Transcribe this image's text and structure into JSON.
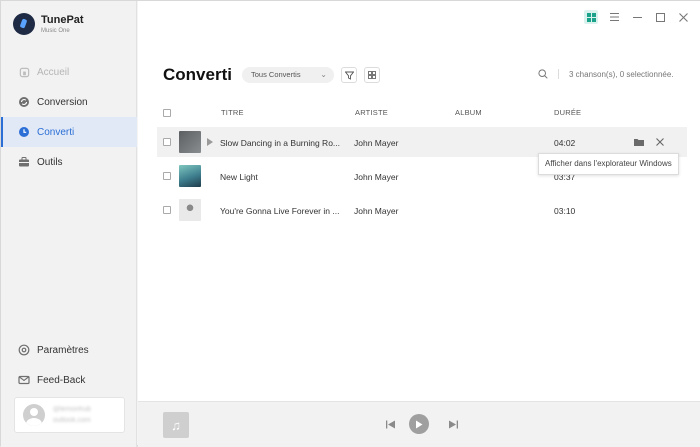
{
  "app": {
    "name": "TunePat",
    "subtitle": "Music One"
  },
  "colors": {
    "accent": "#2b6fd6",
    "active_bg": "#e1e9f6"
  },
  "sidebar": {
    "items": [
      {
        "label": "Accueil",
        "icon": "home-icon",
        "state": "disabled"
      },
      {
        "label": "Conversion",
        "icon": "refresh-icon",
        "state": "normal"
      },
      {
        "label": "Converti",
        "icon": "clock-icon",
        "state": "active"
      },
      {
        "label": "Outils",
        "icon": "toolbox-icon",
        "state": "normal"
      }
    ],
    "bottom_items": [
      {
        "label": "Paramètres",
        "icon": "gear-icon"
      },
      {
        "label": "Feed-Back",
        "icon": "mail-icon"
      }
    ],
    "user": {
      "line1": "@lemonhub",
      "line2": "outlook.com"
    }
  },
  "window_controls": [
    "grid-view-icon",
    "menu-icon",
    "minimize-icon",
    "maximize-icon",
    "close-icon"
  ],
  "main": {
    "title": "Converti",
    "filter": {
      "selected": "Tous Convertis"
    },
    "count_text": "3 chanson(s), 0 selectionnée.",
    "columns": {
      "title": "TITRE",
      "artist": "ARTISTE",
      "album": "ALBUM",
      "duration": "DURÉE"
    },
    "rows": [
      {
        "title": "Slow Dancing in a Burning Ro...",
        "artist": "John Mayer",
        "album": "",
        "duration": "04:02"
      },
      {
        "title": "New Light",
        "artist": "John Mayer",
        "album": "",
        "duration": "03:37"
      },
      {
        "title": "You're Gonna Live Forever in ...",
        "artist": "John Mayer",
        "album": "",
        "duration": "03:10"
      }
    ],
    "tooltip": "Afficher dans l'explorateur Windows"
  },
  "player": {
    "controls": [
      "prev-icon",
      "play-icon",
      "next-icon"
    ]
  }
}
